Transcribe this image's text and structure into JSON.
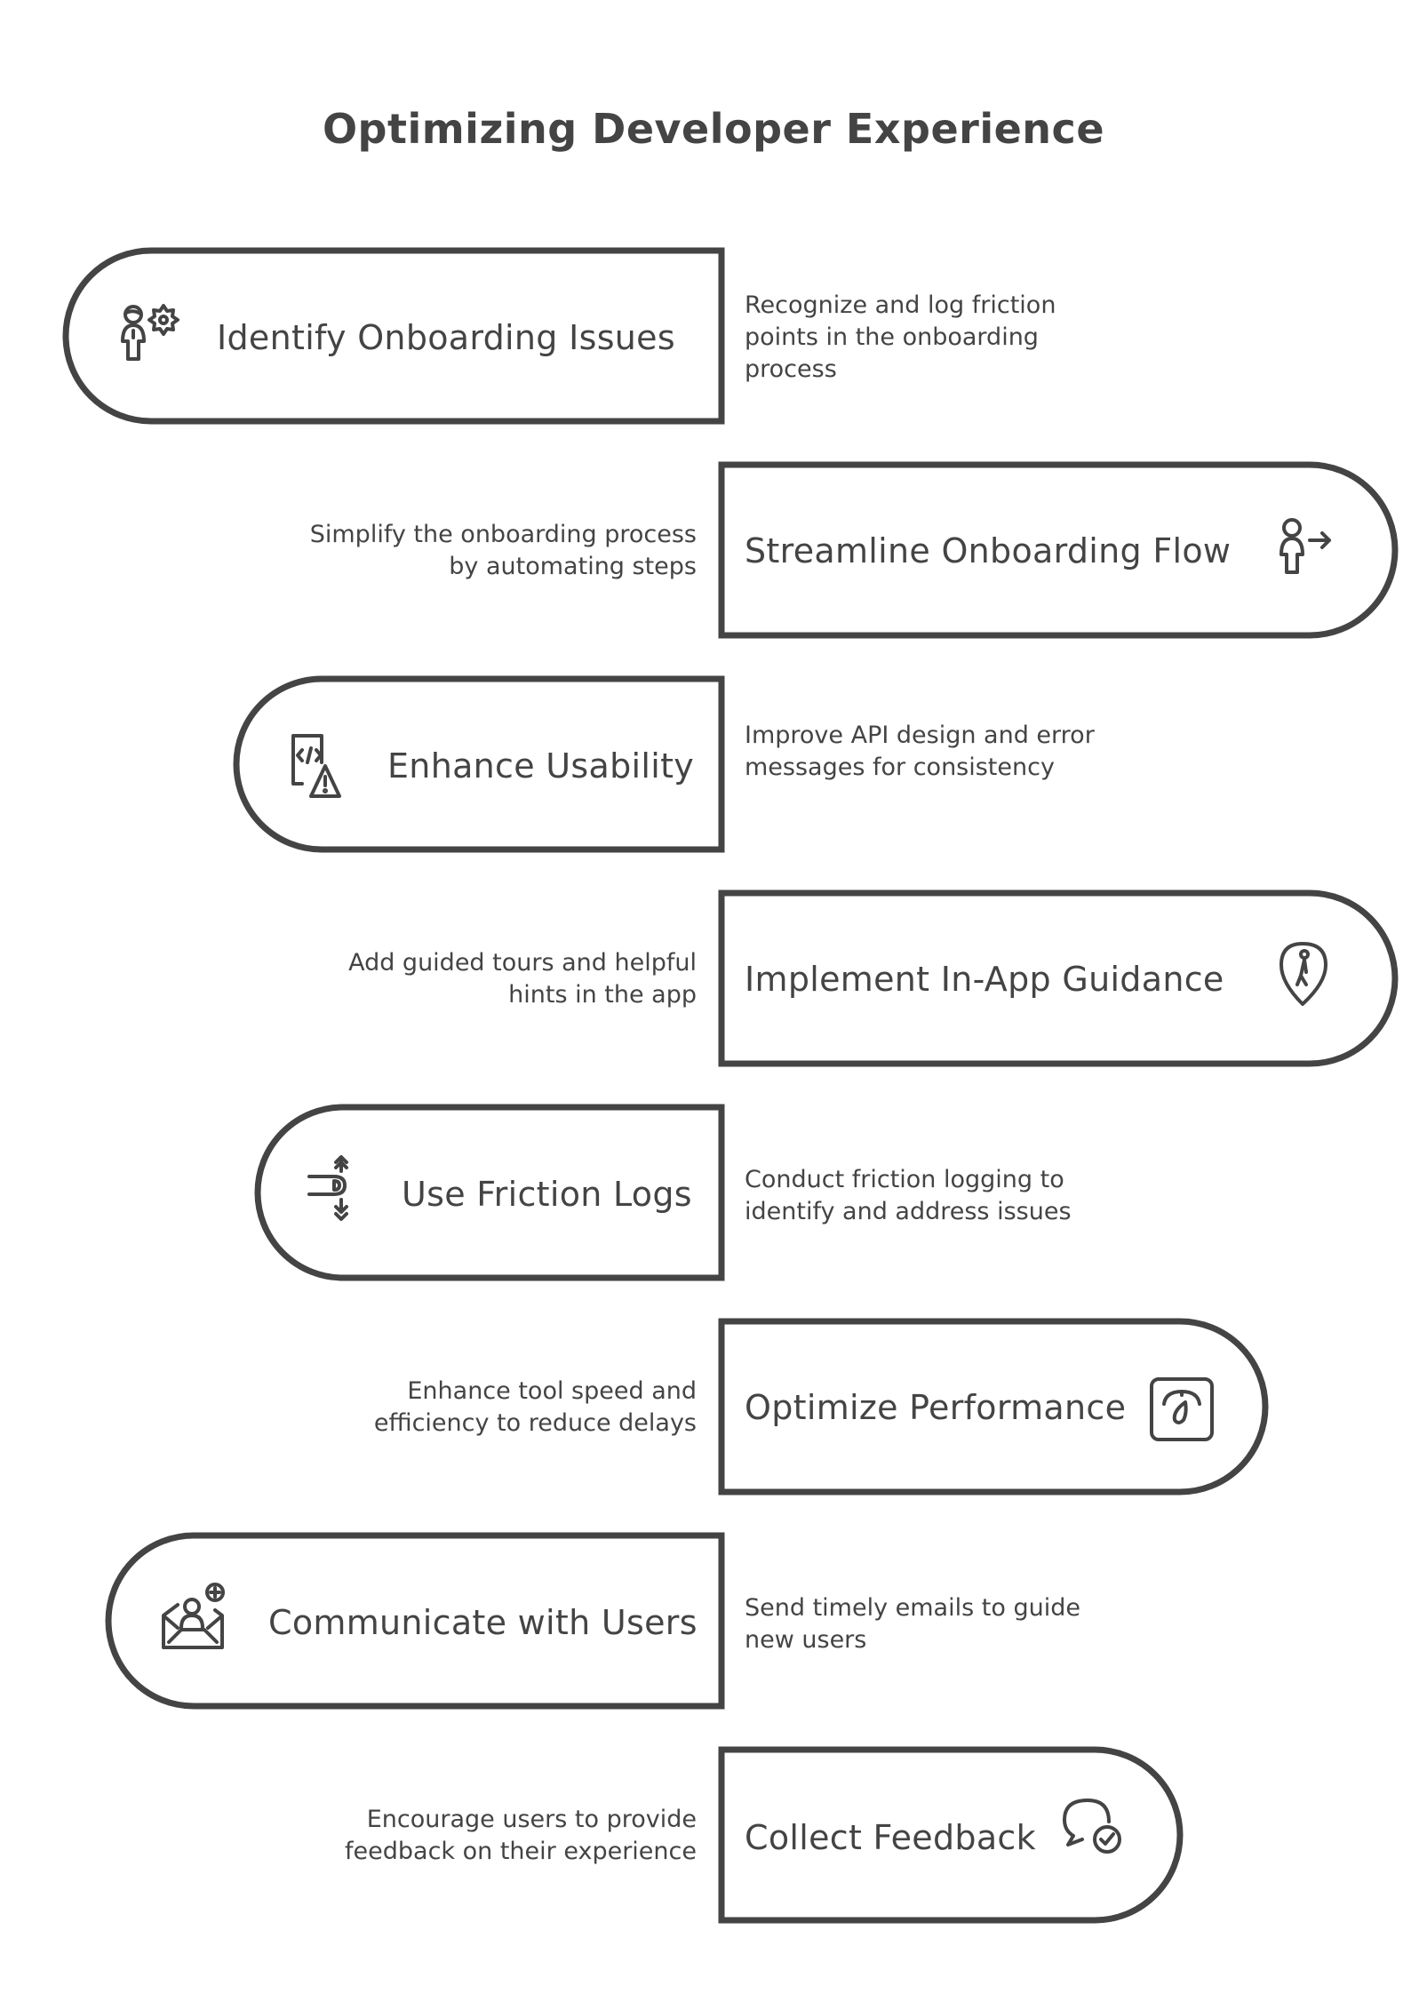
{
  "title": "Optimizing Developer Experience",
  "steps": [
    {
      "label": "Identify Onboarding Issues",
      "description": "Recognize and log friction points in the onboarding process",
      "icon": "person-gear-icon"
    },
    {
      "label": "Streamline Onboarding Flow",
      "description": "Simplify the onboarding process by automating steps",
      "icon": "person-arrow-icon"
    },
    {
      "label": "Enhance Usability",
      "description": "Improve API design and error messages for consistency",
      "icon": "code-warning-icon"
    },
    {
      "label": "Implement In-App Guidance",
      "description": "Add guided tours and helpful hints in the app",
      "icon": "location-person-icon"
    },
    {
      "label": "Use Friction Logs",
      "description": "Conduct friction logging to identify and address issues",
      "icon": "friction-log-icon"
    },
    {
      "label": "Optimize Performance",
      "description": "Enhance tool speed and efficiency to reduce delays",
      "icon": "gauge-icon"
    },
    {
      "label": "Communicate with Users",
      "description": "Send timely emails to guide new users",
      "icon": "email-user-icon"
    },
    {
      "label": "Collect Feedback",
      "description": "Encourage users to provide feedback on their experience",
      "icon": "chat-check-icon"
    }
  ],
  "colors": {
    "stroke": "#444444",
    "background": "#ffffff"
  }
}
